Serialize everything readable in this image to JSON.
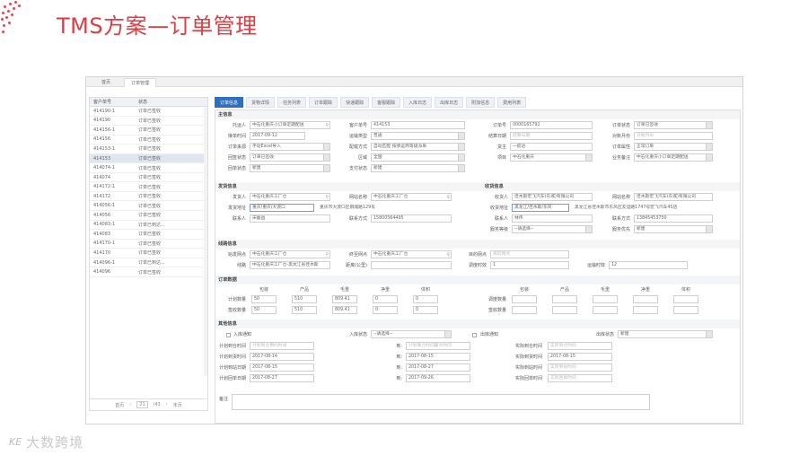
{
  "slide": {
    "title": "TMS方案—订单管理",
    "brand": "大数跨境",
    "brand_mark": "KE"
  },
  "app": {
    "top_tabs": [
      "首页",
      "订单管理"
    ],
    "left": {
      "col1": "客户单号",
      "col2": "状态",
      "rows": [
        [
          "414190-1",
          "订单已签收"
        ],
        [
          "414190",
          "订单已签收"
        ],
        [
          "414156-1",
          "订单已签收"
        ],
        [
          "414156",
          "订单已签收"
        ],
        [
          "414153-1",
          "订单已签收"
        ],
        [
          "414153",
          "订单已签收"
        ],
        [
          "414074-1",
          "订单已签收"
        ],
        [
          "414074",
          "订单已签收"
        ],
        [
          "414172-1",
          "订单已签收"
        ],
        [
          "414172",
          "订单已签收"
        ],
        [
          "414056-1",
          "订单已签收"
        ],
        [
          "414056",
          "订单已签收"
        ],
        [
          "414083-1",
          "订单已到达..."
        ],
        [
          "414083",
          "订单已签收"
        ],
        [
          "414170-1",
          "订单已签收"
        ],
        [
          "414170",
          "订单已签收"
        ],
        [
          "414096-1",
          "订单已到达..."
        ],
        [
          "414096",
          "订单已签收"
        ]
      ],
      "pager": {
        "prev": "首页",
        "current": "21",
        "total": "/43",
        "next": "末页"
      }
    },
    "tabs": [
      "订单信息",
      "货物详情",
      "任务列表",
      "订单跟踪",
      "快递跟踪",
      "客服跟踪",
      "入库日志",
      "出库日志",
      "附加信息",
      "费用列表"
    ],
    "sections": {
      "main": "主信息",
      "sender": "发货信息",
      "receiver": "收货信息",
      "line": "线路信息",
      "order": "订单数据",
      "other": "其他信息"
    },
    "main_fields": {
      "client_label": "托运人",
      "client": "中石化重庆小订单定期配送",
      "custno_label": "客户单号",
      "custno": "414153",
      "orderno_label": "订单号",
      "orderno": "0000165792",
      "status_label": "订单状态",
      "status": "订单已签收",
      "date_label": "接单时间",
      "date": "2017-09-12",
      "transport_label": "运输类型",
      "transport": "普通",
      "settle_label": "结算日期",
      "settle": "结算日期",
      "receipt_label": "对账月份",
      "receipt": "对账月份",
      "source_label": "订单来源",
      "source": "手动Excel导入",
      "delivery_label": "配载方式",
      "delivery": "自动匹配 按承运商等级派单",
      "gate_label": "货主",
      "gate": "一航达",
      "attr_label": "订单属性",
      "attr": "正常订单",
      "receipt_status_label": "回签状态",
      "receipt_status": "订单已签收",
      "region_label": "区域",
      "region": "全国",
      "item_label": "项目",
      "item": "中石化重庆",
      "biz_label": "业务备注",
      "biz": "中石化重庆小订单定期配送",
      "return_label": "回单状态",
      "return_status": "新建",
      "pay_label": "支付状态",
      "pay": "新建"
    },
    "sender": {
      "name_label": "发货人",
      "name": "中石化重庆工厂仓",
      "code_label": "网站名称",
      "code": "中石化重庆工厂仓",
      "addr_label": "发货地址",
      "addr": "重庆/重庆/大渡口",
      "addr2": "重庆市大渡口区钢城路129号",
      "contact_label": "联系人",
      "contact": "宋磊昌",
      "phone_label": "联系方式",
      "phone": "15800564495"
    },
    "receiver": {
      "name_label": "收货人",
      "name": "佳木斯宏飞汽车(东城)有限公司",
      "site_label": "网站名称",
      "site": "佳木斯宏飞汽车(东城)有限公司",
      "addr_label": "收货地址",
      "addr": "黑龙江/佳木斯/东风",
      "addr2": "黑龙江省佳木斯市东风区友谊路1747号宏飞汽车4S店",
      "contact_label": "联系人",
      "contact": "林伟",
      "phone_label": "联系方式",
      "phone": "13845453750",
      "svc_label": "服务等级",
      "svc": "--请选择--",
      "svc2_label": "服务优先",
      "svc2": "新建"
    },
    "line": {
      "start_label": "始发网点",
      "start": "中石化重庆工厂仓",
      "end_label": "终至网点",
      "end": "中石化重庆工厂仓",
      "dest_label": "目的网点",
      "dest": "目的网点",
      "route_label": "线路",
      "route": "中石化重庆工厂仓-黑龙江省佳木斯",
      "dist_label": "距离(公里)",
      "dist": "",
      "days_label": "调度时效",
      "days": "1",
      "hours_label": "运输时效",
      "hours": "12"
    },
    "order_data": {
      "cols": [
        "包装",
        "产品",
        "毛重",
        "净重",
        "体积"
      ],
      "rows": [
        {
          "label": "计划数量",
          "vals": [
            "50",
            "510",
            "809.41",
            "0",
            "0"
          ]
        },
        {
          "label": "签收数量",
          "vals": [
            "50",
            "510",
            "809.41",
            "0",
            "0"
          ]
        }
      ],
      "cols2": [
        "包装",
        "产品",
        "毛重",
        "净重",
        "体积"
      ],
      "rows2": [
        {
          "label": "调度数量"
        },
        {
          "label": "签收数量"
        }
      ]
    },
    "other": {
      "in_label": "入库通知",
      "in_status_label": "入库状态",
      "in_status": "--请选择--",
      "out_label": "出库通知",
      "out_status_label": "出库状态",
      "out_status": "新建",
      "rows": [
        {
          "l1": "计划到仓时间",
          "v1": "计划到仓预约时间",
          "l2": "到:",
          "v2": "计划离仓时间最大时间",
          "l3": "实际到仓时间",
          "v3": "实际到仓时间"
        },
        {
          "l1": "计划到货时间",
          "v1": "2017-08-14",
          "l2": "到:",
          "v2": "2017-08-15",
          "l3": "实际到货时间",
          "v3": "2017-08-15"
        },
        {
          "l1": "计划到站日期",
          "v1": "2017-08-15",
          "l2": "到:",
          "v2": "2017-08-27",
          "l3": "实际到站时间",
          "v3": "实际到站时间"
        },
        {
          "l1": "计划回单日期",
          "v1": "2017-08-27",
          "l2": "到:",
          "v2": "2017-09-26",
          "l3": "实际回单时间",
          "v3": "实际回单时间"
        }
      ],
      "remark_label": "备注"
    }
  }
}
